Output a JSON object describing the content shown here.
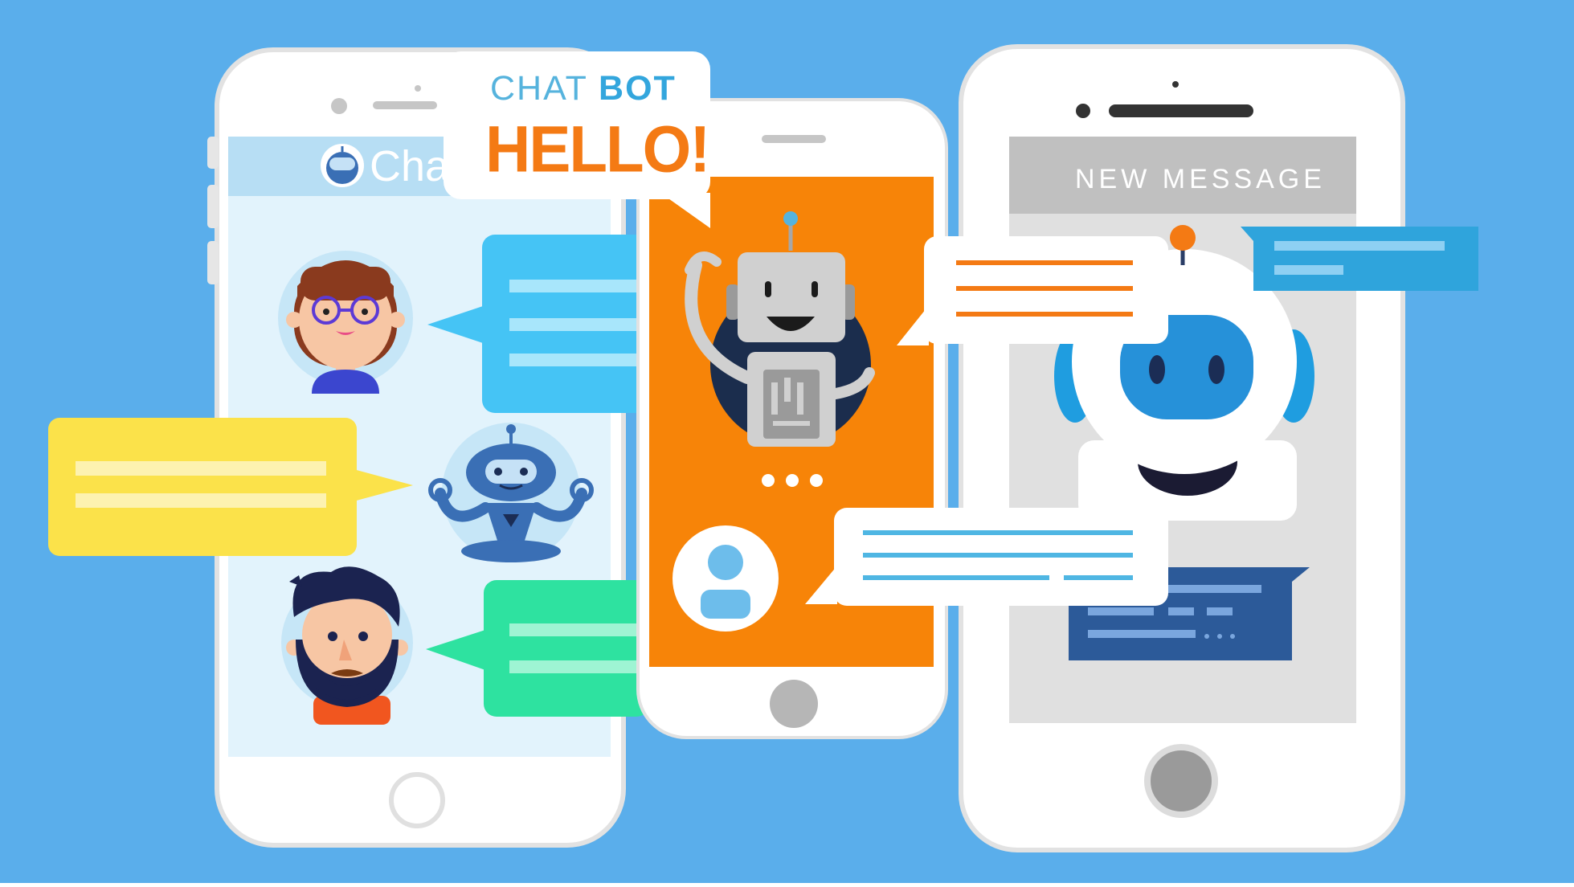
{
  "colors": {
    "background": "#5aaeeb",
    "phone_body": "#ffffff",
    "phone_outline": "#e2e2e2",
    "left_screen": "#e2f3fc",
    "left_header": "#b7def4",
    "middle_screen": "#f78408",
    "right_screen": "#e0e0e0",
    "right_header": "#c0c0c0",
    "bubble_blue": "#45c4f5",
    "bubble_yellow": "#fbe24a",
    "bubble_green": "#2ee2a0",
    "bubble_white": "#ffffff",
    "line_orange": "#f47a14",
    "line_blue": "#4fb6e3",
    "dark_blue_card": "#2c5a99",
    "hello_orange": "#f47a14"
  },
  "icons": [
    "chatbot-logo-icon",
    "girl-avatar-icon",
    "meditating-robot-icon",
    "bearded-man-avatar-icon",
    "waving-robot-icon",
    "user-profile-icon",
    "big-robot-head-icon",
    "typing-dots-icon",
    "home-button-icon"
  ],
  "hello_bubble": {
    "line1_part1": "CHAT",
    "line1_part2": "BOT",
    "line2": "HELLO!"
  },
  "left_phone": {
    "app_title": "Chat"
  },
  "right_phone": {
    "header": "NEW MESSAGE"
  }
}
